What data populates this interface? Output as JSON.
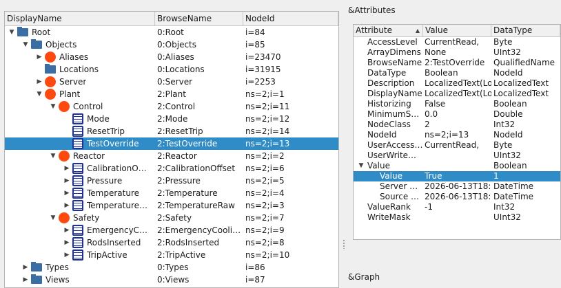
{
  "tree": {
    "columns": [
      "DisplayName",
      "BrowseName",
      "NodeId"
    ],
    "rows": [
      {
        "depth": 0,
        "arrow": "down",
        "icon": "folder",
        "name": "Root",
        "browse": "0:Root",
        "id": "i=84",
        "sel": false
      },
      {
        "depth": 1,
        "arrow": "down",
        "icon": "folder",
        "name": "Objects",
        "browse": "0:Objects",
        "id": "i=85",
        "sel": false
      },
      {
        "depth": 2,
        "arrow": "right",
        "icon": "object",
        "name": "Aliases",
        "browse": "0:Aliases",
        "id": "i=23470",
        "sel": false
      },
      {
        "depth": 2,
        "arrow": "none",
        "icon": "folder",
        "name": "Locations",
        "browse": "0:Locations",
        "id": "i=31915",
        "sel": false
      },
      {
        "depth": 2,
        "arrow": "right",
        "icon": "object",
        "name": "Server",
        "browse": "0:Server",
        "id": "i=2253",
        "sel": false
      },
      {
        "depth": 2,
        "arrow": "down",
        "icon": "object",
        "name": "Plant",
        "browse": "2:Plant",
        "id": "ns=2;i=1",
        "sel": false
      },
      {
        "depth": 3,
        "arrow": "down",
        "icon": "object",
        "name": "Control",
        "browse": "2:Control",
        "id": "ns=2;i=11",
        "sel": false
      },
      {
        "depth": 4,
        "arrow": "none",
        "icon": "variable",
        "name": "Mode",
        "browse": "2:Mode",
        "id": "ns=2;i=12",
        "sel": false
      },
      {
        "depth": 4,
        "arrow": "none",
        "icon": "variable",
        "name": "ResetTrip",
        "browse": "2:ResetTrip",
        "id": "ns=2;i=14",
        "sel": false
      },
      {
        "depth": 4,
        "arrow": "none",
        "icon": "variable",
        "name": "TestOverride",
        "browse": "2:TestOverride",
        "id": "ns=2;i=13",
        "sel": true
      },
      {
        "depth": 3,
        "arrow": "down",
        "icon": "object",
        "name": "Reactor",
        "browse": "2:Reactor",
        "id": "ns=2;i=2",
        "sel": false
      },
      {
        "depth": 4,
        "arrow": "right",
        "icon": "variable",
        "name": "CalibrationO…",
        "browse": "2:CalibrationOffset",
        "id": "ns=2;i=6",
        "sel": false
      },
      {
        "depth": 4,
        "arrow": "right",
        "icon": "variable",
        "name": "Pressure",
        "browse": "2:Pressure",
        "id": "ns=2;i=5",
        "sel": false
      },
      {
        "depth": 4,
        "arrow": "right",
        "icon": "variable",
        "name": "Temperature",
        "browse": "2:Temperature",
        "id": "ns=2;i=4",
        "sel": false
      },
      {
        "depth": 4,
        "arrow": "right",
        "icon": "variable",
        "name": "Temperature…",
        "browse": "2:TemperatureRaw",
        "id": "ns=2;i=3",
        "sel": false
      },
      {
        "depth": 3,
        "arrow": "down",
        "icon": "object",
        "name": "Safety",
        "browse": "2:Safety",
        "id": "ns=2;i=7",
        "sel": false
      },
      {
        "depth": 4,
        "arrow": "right",
        "icon": "variable",
        "name": "EmergencyC…",
        "browse": "2:EmergencyCooli…",
        "id": "ns=2;i=9",
        "sel": false
      },
      {
        "depth": 4,
        "arrow": "right",
        "icon": "variable",
        "name": "RodsInserted",
        "browse": "2:RodsInserted",
        "id": "ns=2;i=8",
        "sel": false
      },
      {
        "depth": 4,
        "arrow": "right",
        "icon": "variable",
        "name": "TripActive",
        "browse": "2:TripActive",
        "id": "ns=2;i=10",
        "sel": false
      },
      {
        "depth": 1,
        "arrow": "right",
        "icon": "folder",
        "name": "Types",
        "browse": "0:Types",
        "id": "i=86",
        "sel": false
      },
      {
        "depth": 1,
        "arrow": "right",
        "icon": "folder",
        "name": "Views",
        "browse": "0:Views",
        "id": "i=87",
        "sel": false
      }
    ]
  },
  "attributes": {
    "title": "&Attributes",
    "columns": [
      "Attribute",
      "Value",
      "DataType"
    ],
    "rows": [
      {
        "depth": 0,
        "arrow": "none",
        "name": "AccessLevel",
        "value": "CurrentRead,",
        "type": "Byte",
        "sel": false
      },
      {
        "depth": 0,
        "arrow": "none",
        "name": "ArrayDimens",
        "value": "None",
        "type": "UInt32",
        "sel": false
      },
      {
        "depth": 0,
        "arrow": "none",
        "name": "BrowseName",
        "value": "2:TestOverride",
        "type": "QualifiedName",
        "sel": false
      },
      {
        "depth": 0,
        "arrow": "none",
        "name": "DataType",
        "value": "Boolean",
        "type": "NodeId",
        "sel": false
      },
      {
        "depth": 0,
        "arrow": "none",
        "name": "Description",
        "value": "LocalizedText(Lo",
        "type": "LocalizedText",
        "sel": false
      },
      {
        "depth": 0,
        "arrow": "none",
        "name": "DisplayName",
        "value": "LocalizedText(Lo",
        "type": "LocalizedText",
        "sel": false
      },
      {
        "depth": 0,
        "arrow": "none",
        "name": "Historizing",
        "value": "False",
        "type": "Boolean",
        "sel": false
      },
      {
        "depth": 0,
        "arrow": "none",
        "name": "MinimumSam",
        "value": "0.0",
        "type": "Double",
        "sel": false
      },
      {
        "depth": 0,
        "arrow": "none",
        "name": "NodeClass",
        "value": "2",
        "type": "Int32",
        "sel": false
      },
      {
        "depth": 0,
        "arrow": "none",
        "name": "NodeId",
        "value": "ns=2;i=13",
        "type": "NodeId",
        "sel": false
      },
      {
        "depth": 0,
        "arrow": "none",
        "name": "UserAccessLe",
        "value": "CurrentRead,",
        "type": "Byte",
        "sel": false
      },
      {
        "depth": 0,
        "arrow": "none",
        "name": "UserWriteMas",
        "value": "",
        "type": "UInt32",
        "sel": false
      },
      {
        "depth": 0,
        "arrow": "down",
        "name": "Value",
        "value": "",
        "type": "Boolean",
        "sel": false
      },
      {
        "depth": 1,
        "arrow": "none",
        "name": "Value",
        "value": "True",
        "type": "1",
        "sel": true
      },
      {
        "depth": 1,
        "arrow": "none",
        "name": "Server …",
        "value": "2026-06-13T18:",
        "type": "DateTime",
        "sel": false
      },
      {
        "depth": 1,
        "arrow": "none",
        "name": "Source …",
        "value": "2026-06-13T18:",
        "type": "DateTime",
        "sel": false
      },
      {
        "depth": 0,
        "arrow": "none",
        "name": "ValueRank",
        "value": "-1",
        "type": "Int32",
        "sel": false
      },
      {
        "depth": 0,
        "arrow": "none",
        "name": "WriteMask",
        "value": "",
        "type": "UInt32",
        "sel": false
      }
    ]
  },
  "graph": {
    "title": "&Graph"
  }
}
